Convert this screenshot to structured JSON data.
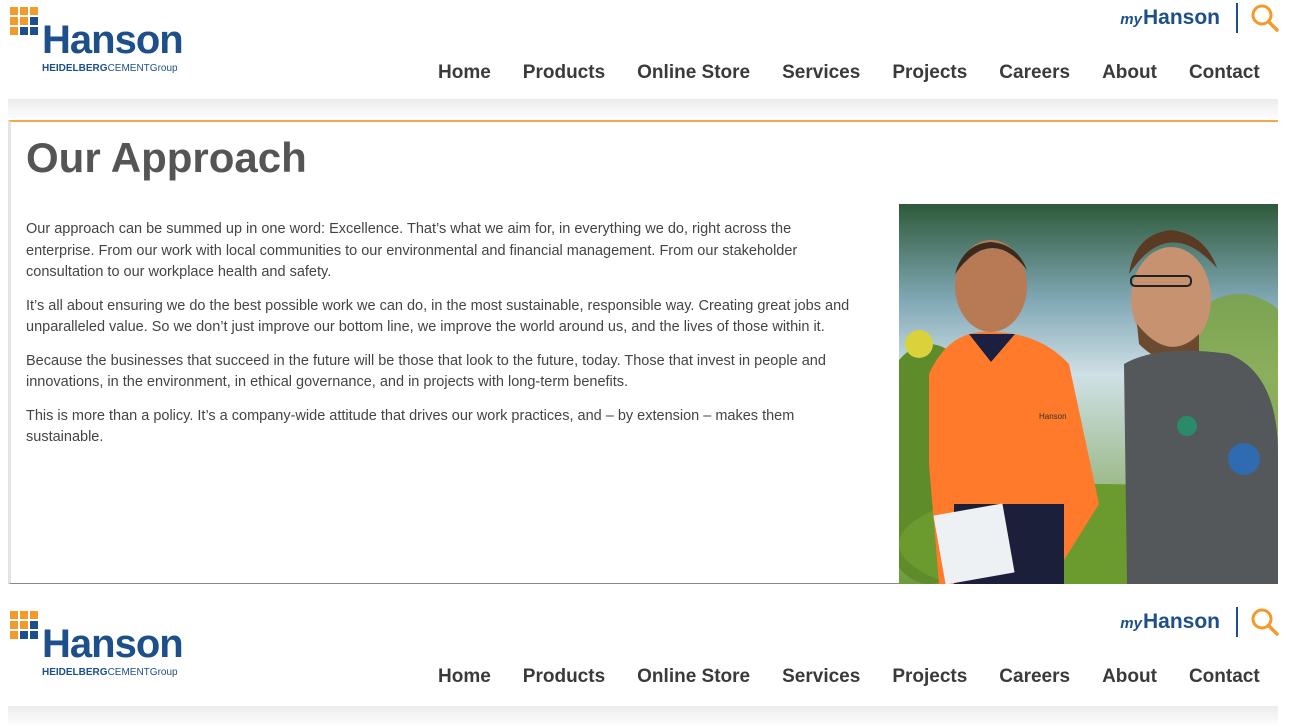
{
  "brand": {
    "logo_word": "Hanson",
    "logo_sub_bold": "HEIDELBERG",
    "logo_sub_rest": "CEMENTGroup",
    "colors": {
      "brand_blue": "#1d4f8a",
      "brand_orange": "#f39a2b",
      "accent_line": "#f3a64a"
    }
  },
  "util": {
    "my_prefix": "my",
    "my_name": "Hanson",
    "search_icon": "search-icon"
  },
  "nav": {
    "items": [
      "Home",
      "Products",
      "Online Store",
      "Services",
      "Projects",
      "Careers",
      "About",
      "Contact"
    ]
  },
  "page": {
    "title": "Our Approach",
    "paragraphs": [
      "Our approach can be summed up in one word: Excellence. That’s what we aim for, in everything we do, right across the enterprise. From our work with local communities to our environmental and financial management. From our stakeholder consultation to our workplace health and safety.",
      "It’s all about ensuring we do the best possible work we can do, in the most sustainable, responsible way. Creating great jobs and unparalleled value. So we don’t just improve our bottom line, we improve the world around us, and the lives of those within it.",
      "Because the businesses that succeed in the future will be those that look to the future, today. Those that invest in people and innovations, in the environment, in ethical governance, and in projects with long-term benefits.",
      "This is more than a policy. It’s a company-wide attitude that drives our work practices, and – by extension – makes them sustainable."
    ]
  },
  "photo": {
    "badge_text": "Hanson"
  }
}
